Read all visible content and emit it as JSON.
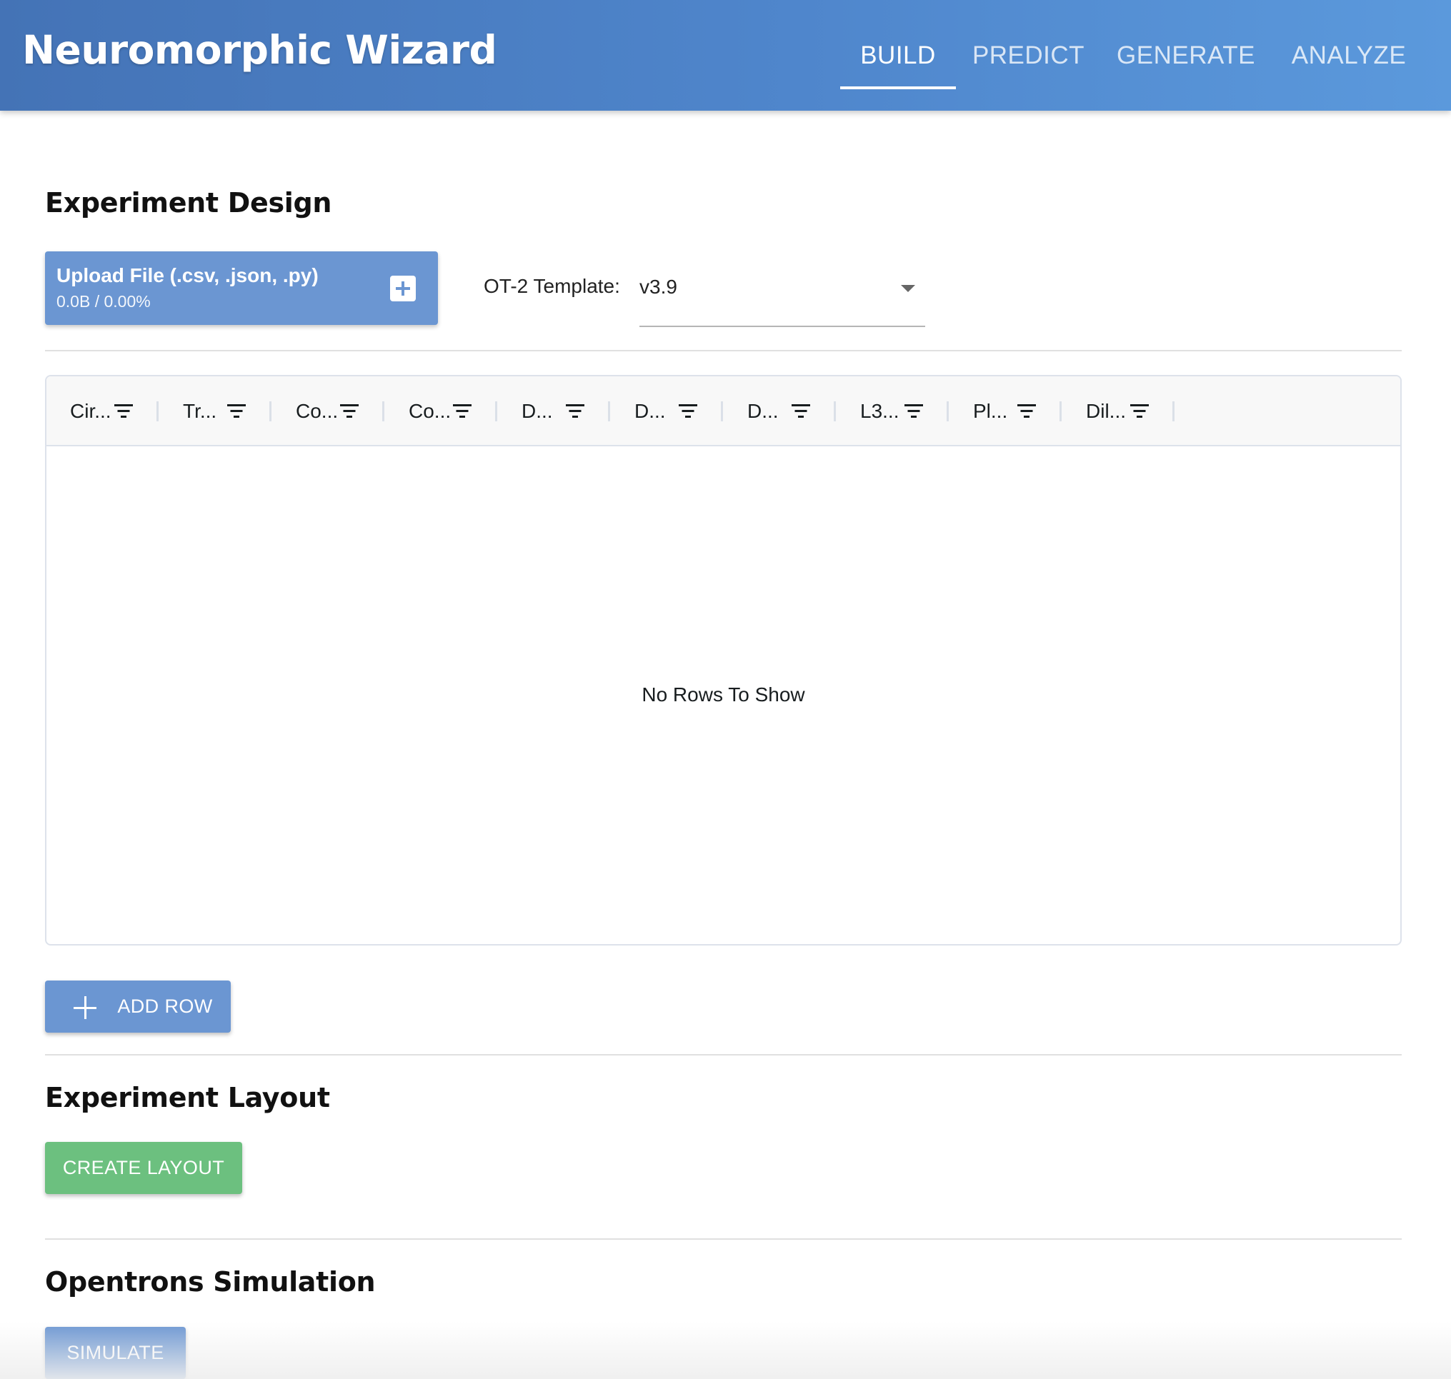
{
  "app": {
    "title": "Neuromorphic Wizard"
  },
  "nav": {
    "tabs": [
      {
        "label": "BUILD",
        "active": true
      },
      {
        "label": "PREDICT",
        "active": false
      },
      {
        "label": "GENERATE",
        "active": false
      },
      {
        "label": "ANALYZE",
        "active": false
      }
    ]
  },
  "design": {
    "title": "Experiment Design",
    "upload": {
      "label": "Upload File (.csv, .json, .py)",
      "progress": "0.0B / 0.00%",
      "icon": "plus-box-icon"
    },
    "template": {
      "label": "OT-2 Template:",
      "value": "v3.9"
    },
    "grid": {
      "columns": [
        "Cir...",
        "Tr...",
        "Co...",
        "Co...",
        "D...",
        "D...",
        "D...",
        "L3...",
        "Pl...",
        "Dil..."
      ],
      "empty_message": "No Rows To Show"
    },
    "add_row_label": "ADD ROW"
  },
  "layout": {
    "title": "Experiment Layout",
    "create_label": "CREATE LAYOUT"
  },
  "simulation": {
    "title": "Opentrons Simulation",
    "simulate_label": "SIMULATE"
  },
  "colors": {
    "header_start": "#4473b6",
    "header_end": "#5b99dc",
    "primary_button": "#6b96d2",
    "success_button": "#6cc07f"
  }
}
